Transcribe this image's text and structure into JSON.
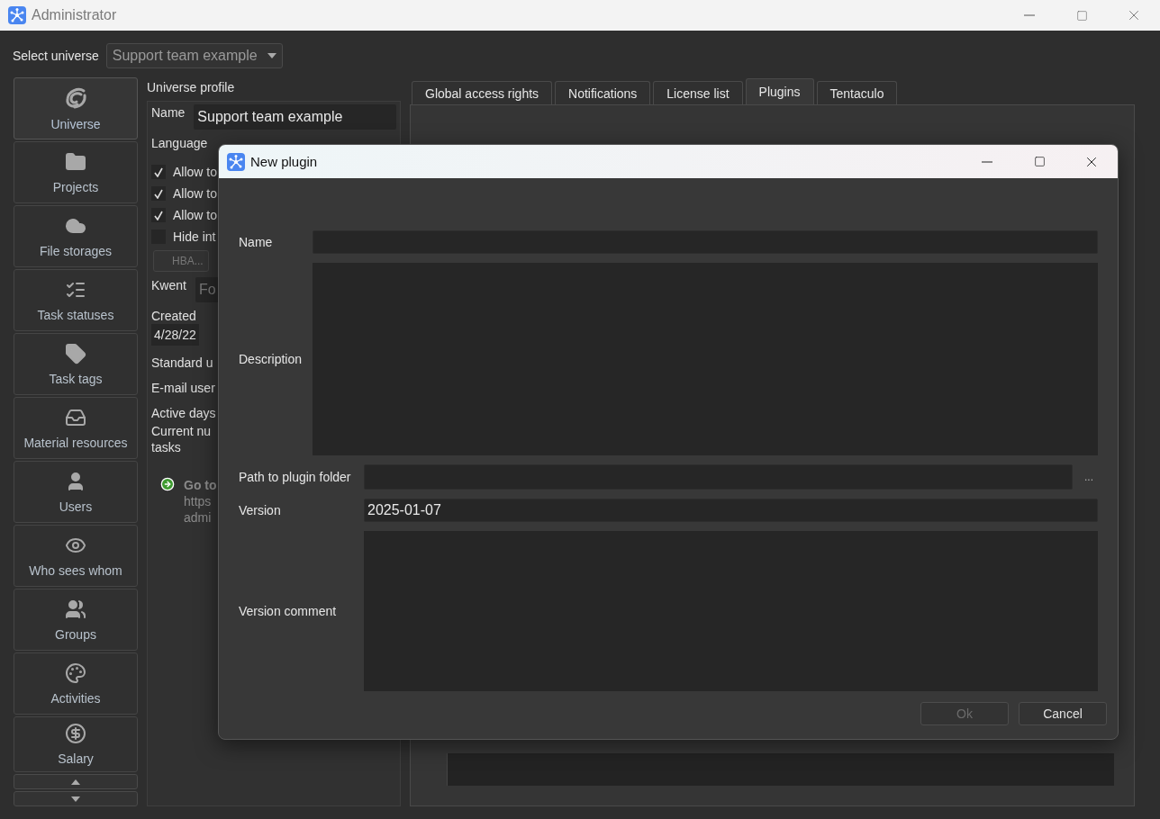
{
  "window": {
    "title": "Administrator"
  },
  "universe_select": {
    "label": "Select universe",
    "value": "Support team example"
  },
  "sidebar": {
    "items": [
      {
        "label": "Universe",
        "selected": true
      },
      {
        "label": "Projects",
        "selected": false
      },
      {
        "label": "File storages",
        "selected": false
      },
      {
        "label": "Task statuses",
        "selected": false
      },
      {
        "label": "Task tags",
        "selected": false
      },
      {
        "label": "Material resources",
        "selected": false
      },
      {
        "label": "Users",
        "selected": false
      },
      {
        "label": "Who sees whom",
        "selected": false
      },
      {
        "label": "Groups",
        "selected": false
      },
      {
        "label": "Activities",
        "selected": false
      },
      {
        "label": "Salary",
        "selected": false
      }
    ]
  },
  "profile": {
    "title": "Universe profile",
    "name_label": "Name",
    "name_value": "Support team example",
    "language_label": "Language",
    "checkboxes": [
      {
        "label": "Allow to",
        "checked": true
      },
      {
        "label": "Allow to",
        "checked": true
      },
      {
        "label": "Allow to",
        "checked": true
      },
      {
        "label": "Hide int",
        "checked": false
      }
    ],
    "button": {
      "label": "HBA...",
      "disabled": true
    },
    "kwent_label": "Kwent",
    "kwent_value": "Fo",
    "created_label": "Created",
    "created_value": "4/28/22",
    "lines": [
      "Standard u",
      "E-mail user",
      "Active days"
    ],
    "last_line": "Current nu\ntasks",
    "link": {
      "title": "Go to",
      "lines": [
        "https",
        "admi"
      ]
    }
  },
  "tabs": [
    {
      "label": "Global access rights",
      "selected": false
    },
    {
      "label": "Notifications",
      "selected": false
    },
    {
      "label": "License list",
      "selected": false
    },
    {
      "label": "Plugins",
      "selected": true
    },
    {
      "label": "Tentaculo",
      "selected": false
    }
  ],
  "dialog": {
    "title": "New plugin",
    "fields": [
      {
        "kind": "input",
        "label": "Name"
      },
      {
        "kind": "textarea",
        "label": "Description"
      },
      {
        "kind": "path",
        "label": "Path to plugin folder",
        "browse": "..."
      },
      {
        "kind": "input",
        "label": "Version",
        "value": "2025-01-07"
      },
      {
        "kind": "textarea",
        "label": "Version comment"
      }
    ],
    "buttons": [
      {
        "label": "Ok",
        "disabled": true
      },
      {
        "label": "Cancel",
        "disabled": false
      }
    ]
  }
}
